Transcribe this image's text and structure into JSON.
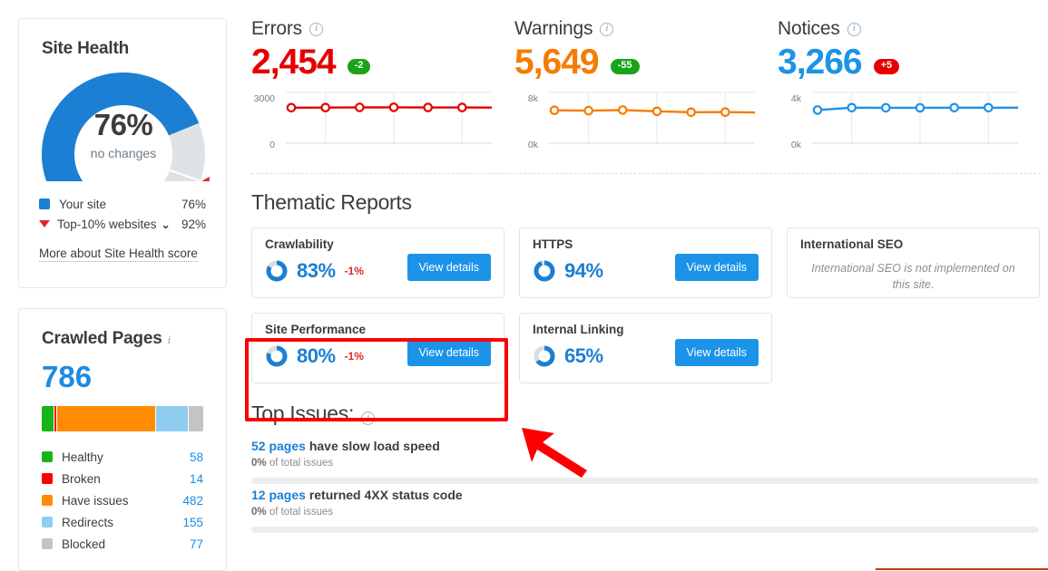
{
  "site_health": {
    "title": "Site Health",
    "gauge_value": "76%",
    "gauge_sub": "no changes",
    "gauge_percent": 76,
    "benchmark_percent": 92,
    "legend": [
      {
        "label": "Your site",
        "value": "76%",
        "color": "#1b7fd4",
        "marker": "square"
      },
      {
        "label": "Top-10% websites",
        "value": "92%",
        "color": "#e02828",
        "marker": "triangle",
        "chevron": "⌄"
      }
    ],
    "more_link": "More about Site Health score"
  },
  "crawled_pages": {
    "title": "Crawled Pages",
    "info_icon": "info-icon",
    "total": "786",
    "segments": [
      {
        "label": "Healthy",
        "value": "58",
        "count": 58,
        "color": "#19b418"
      },
      {
        "label": "Broken",
        "value": "14",
        "count": 14,
        "color": "#fb0000"
      },
      {
        "label": "Have issues",
        "value": "482",
        "count": 482,
        "color": "#ff8c00"
      },
      {
        "label": "Redirects",
        "value": "155",
        "count": 155,
        "color": "#8ecdf0"
      },
      {
        "label": "Blocked",
        "value": "77",
        "count": 77,
        "color": "#c4c4c4"
      }
    ]
  },
  "metrics": [
    {
      "name": "Errors",
      "value": "2,454",
      "color": "#e40000",
      "badge": {
        "text": "-2",
        "color": "#19a319"
      },
      "axis_top": "3000",
      "axis_bottom": "0"
    },
    {
      "name": "Warnings",
      "value": "5,649",
      "color": "#f57c00",
      "badge": {
        "text": "-55",
        "color": "#19a319"
      },
      "axis_top": "8k",
      "axis_bottom": "0k"
    },
    {
      "name": "Notices",
      "value": "3,266",
      "color": "#1b93e8",
      "badge": {
        "text": "+5",
        "color": "#e40000"
      },
      "axis_top": "4k",
      "axis_bottom": "0k"
    }
  ],
  "chart_data": [
    {
      "type": "line",
      "title": "Errors",
      "x": [
        1,
        2,
        3,
        4,
        5,
        6,
        7
      ],
      "values": [
        2450,
        2455,
        2470,
        2475,
        2460,
        2462,
        2454
      ],
      "ylim": [
        0,
        3000
      ],
      "ytick_labels": [
        "3000",
        "0"
      ],
      "color": "#e40000",
      "grid": true,
      "legend": "none"
    },
    {
      "type": "line",
      "title": "Warnings",
      "x": [
        1,
        2,
        3,
        4,
        5,
        6,
        7
      ],
      "values": [
        6050,
        5980,
        6100,
        5870,
        5700,
        5720,
        5649
      ],
      "ylim": [
        0,
        8000
      ],
      "ytick_labels": [
        "8k",
        "0k"
      ],
      "color": "#f57c00",
      "grid": true,
      "legend": "none"
    },
    {
      "type": "line",
      "title": "Notices",
      "x": [
        1,
        2,
        3,
        4,
        5,
        6,
        7
      ],
      "values": [
        3050,
        3270,
        3260,
        3262,
        3264,
        3265,
        3266
      ],
      "ylim": [
        0,
        4000
      ],
      "ytick_labels": [
        "4k",
        "0k"
      ],
      "color": "#1b93e8",
      "grid": true,
      "legend": "none"
    }
  ],
  "thematic": {
    "title": "Thematic Reports",
    "view_details_label": "View details",
    "column1": [
      {
        "title": "Crawlability",
        "percent": "83%",
        "pct": 83,
        "delta": "-1%",
        "has_button": true
      },
      {
        "title": "Site Performance",
        "percent": "80%",
        "pct": 80,
        "delta": "-1%",
        "has_button": true
      }
    ],
    "column2": [
      {
        "title": "HTTPS",
        "percent": "94%",
        "pct": 94,
        "delta": "",
        "has_button": true
      },
      {
        "title": "Internal Linking",
        "percent": "65%",
        "pct": 65,
        "delta": "",
        "has_button": true
      }
    ],
    "column3": [
      {
        "title": "International SEO",
        "na_text": "International SEO is not implemented on this site.",
        "has_button": false
      }
    ]
  },
  "top_issues": {
    "title": "Top Issues:",
    "items": [
      {
        "count": "52 pages",
        "text": " have slow load speed",
        "sub_pct": "0%",
        "sub_text": " of total issues"
      },
      {
        "count": "12 pages",
        "text": " returned 4XX status code",
        "sub_pct": "0%",
        "sub_text": " of total issues"
      }
    ]
  },
  "annotations": {
    "highlight_color": "#fb0000",
    "arrow_color": "#fb0000",
    "bottom_rule_color": "#c0380a"
  }
}
